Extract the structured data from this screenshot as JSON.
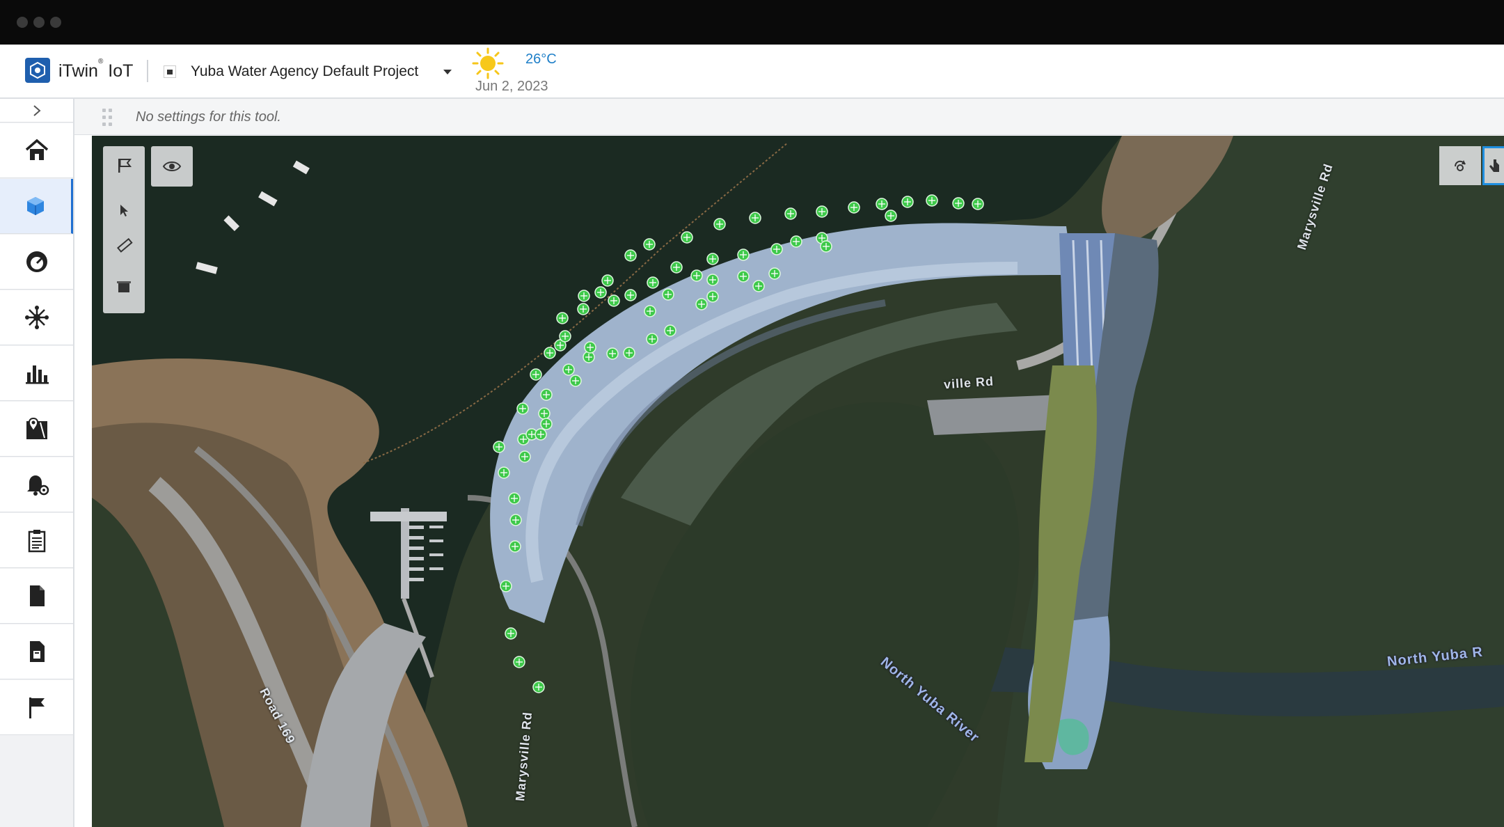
{
  "header": {
    "app_name": "iTwin",
    "app_name_suffix": " IoT",
    "trademark": "®",
    "project_name": "Yuba Water Agency Default Project",
    "weather": {
      "icon": "sun-icon",
      "temperature": "26°C",
      "date": "Jun 2, 2023"
    }
  },
  "sidebar": {
    "expand_icon": "chevron-right-icon",
    "items": [
      {
        "id": "home",
        "icon": "home-icon"
      },
      {
        "id": "model",
        "icon": "cube-icon",
        "active": true
      },
      {
        "id": "dashboard",
        "icon": "gauge-icon"
      },
      {
        "id": "network",
        "icon": "network-icon"
      },
      {
        "id": "charts",
        "icon": "bar-chart-icon"
      },
      {
        "id": "map",
        "icon": "map-pin-icon"
      },
      {
        "id": "alerts",
        "icon": "bell-settings-icon"
      },
      {
        "id": "reports",
        "icon": "clipboard-icon"
      },
      {
        "id": "documents",
        "icon": "document-icon"
      },
      {
        "id": "report-file",
        "icon": "report-file-icon"
      },
      {
        "id": "issues",
        "icon": "flag-icon"
      }
    ]
  },
  "tool_settings": {
    "message": "No settings for this tool."
  },
  "viewport": {
    "labels": {
      "marysville_rd_top": "Marysville Rd",
      "ville_rd": "ville Rd",
      "marysville_rd_bottom": "Marysville Rd",
      "road_169": "Road 169",
      "north_yuba_river": "North Yuba River",
      "north_yuba_r": "North Yuba R"
    },
    "colors": {
      "sensor_marker": "#3ec94a",
      "water": "#1a2a22",
      "accent": "#1f6fd1"
    }
  }
}
